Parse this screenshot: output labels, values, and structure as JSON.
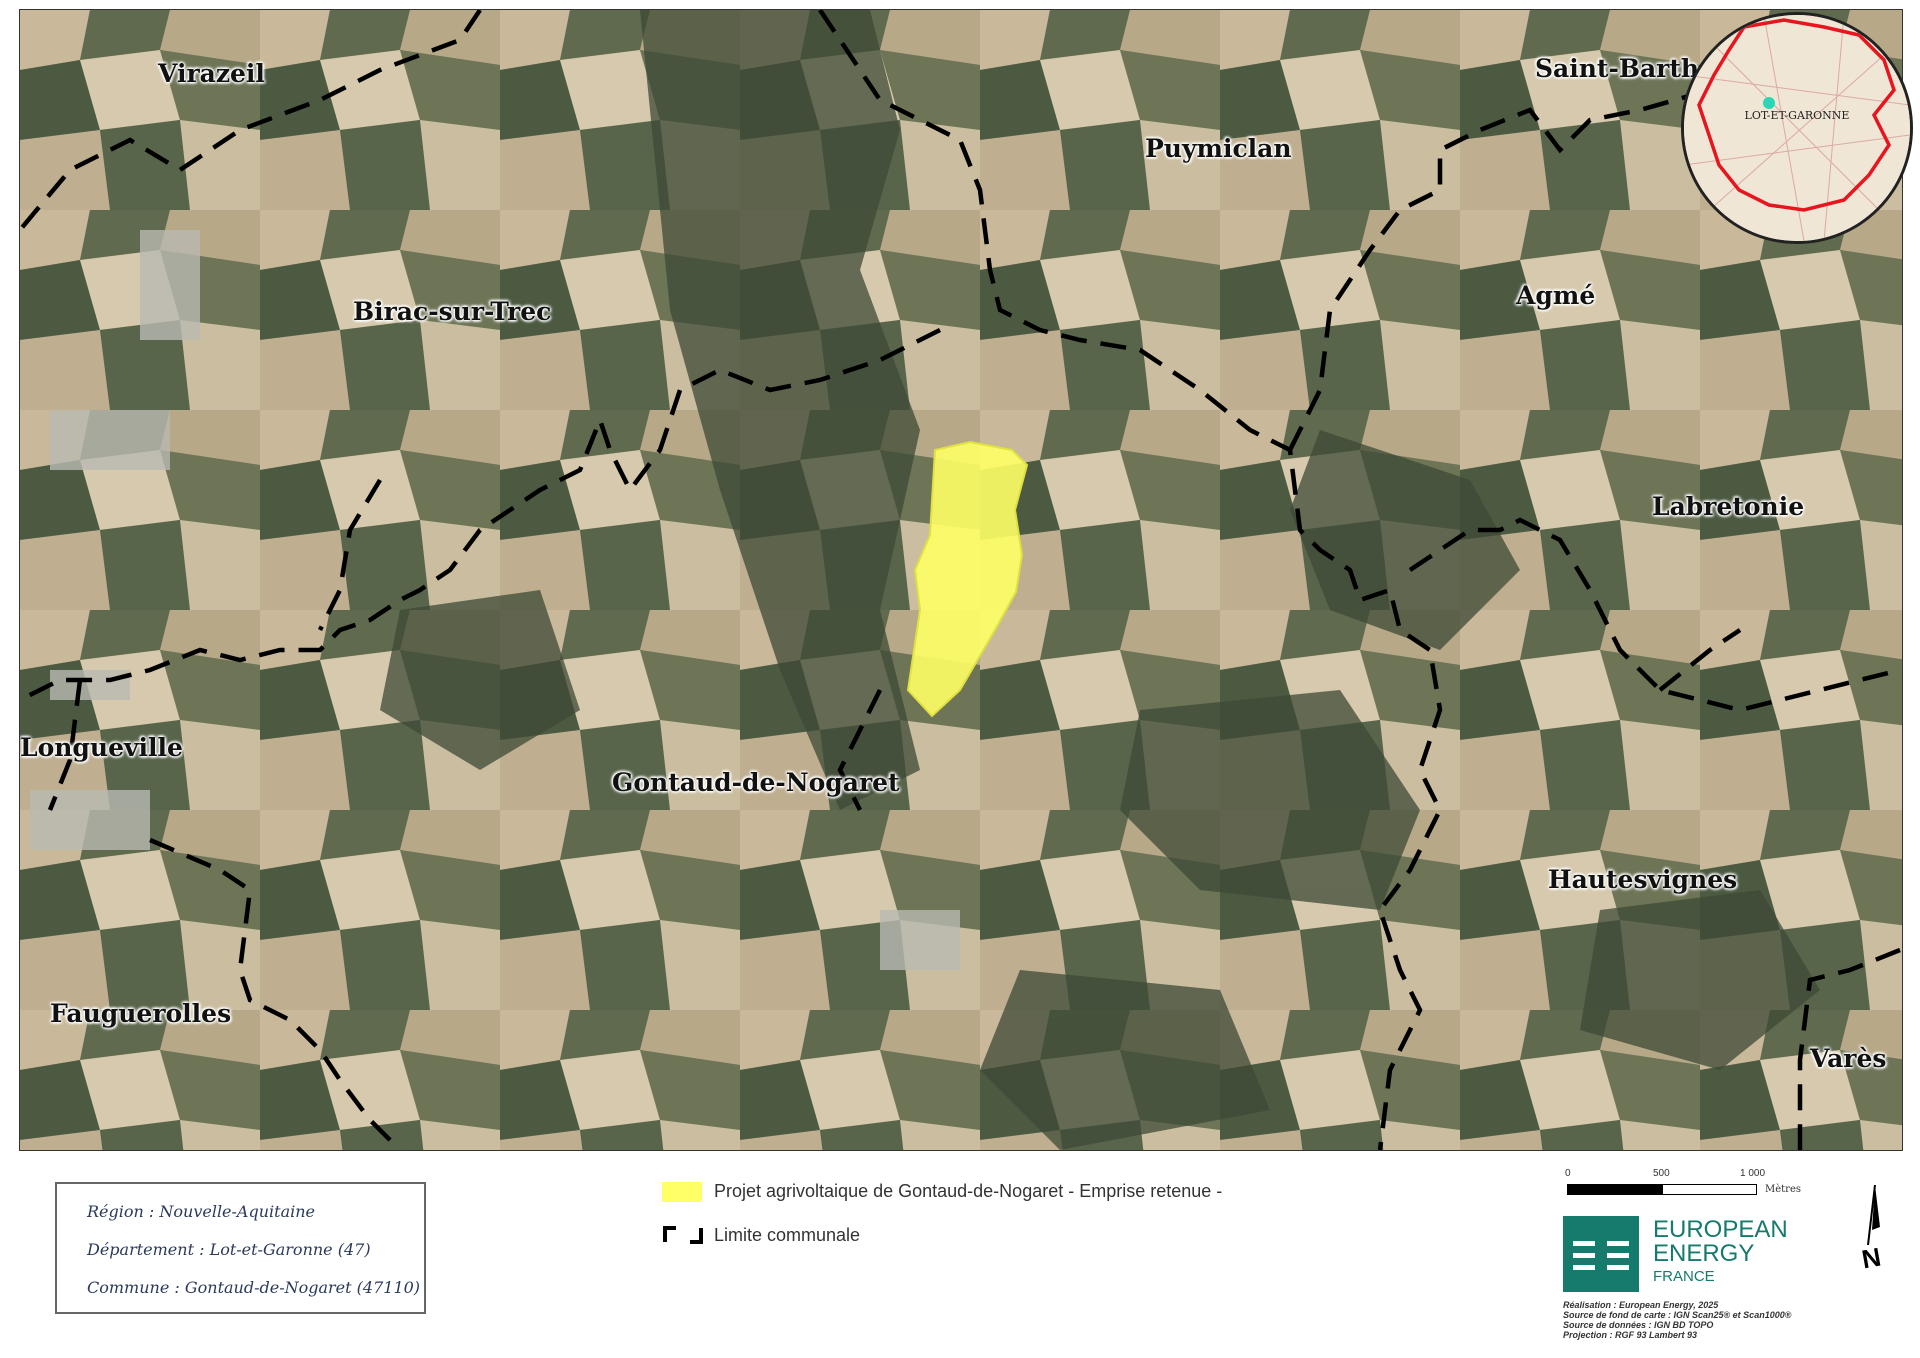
{
  "communes": [
    {
      "id": "virazeil",
      "name": "Virazeil"
    },
    {
      "id": "puymiclan",
      "name": "Puymiclan"
    },
    {
      "id": "saint-barth",
      "name": "Saint-Barth"
    },
    {
      "id": "birac",
      "name": "Birac-sur-Trec"
    },
    {
      "id": "agme",
      "name": "Agmé"
    },
    {
      "id": "labretonie",
      "name": "Labretonie"
    },
    {
      "id": "longueville",
      "name": "Longueville"
    },
    {
      "id": "gontaud",
      "name": "Gontaud-de-Nogaret"
    },
    {
      "id": "hautesvignes",
      "name": "Hautesvignes"
    },
    {
      "id": "fauguerolles",
      "name": "Fauguerolles"
    },
    {
      "id": "vares",
      "name": "Varès"
    }
  ],
  "inset": {
    "label": "LOT-ET-GARONNE"
  },
  "info_box": {
    "region": "Région : Nouvelle-Aquitaine",
    "departement": "Département : Lot-et-Garonne (47)",
    "commune": "Commune : Gontaud-de-Nogaret (47110)"
  },
  "legend": {
    "project": "Projet agrivoltaique de Gontaud-de-Nogaret - Emprise retenue -",
    "boundary": "Limite communale"
  },
  "scale": {
    "tick0": "0",
    "tick1": "500",
    "tick2": "1 000",
    "unit": "Mètres"
  },
  "north": {
    "letter": "N"
  },
  "logo": {
    "line1": "EUROPEAN",
    "line2": "ENERGY",
    "line3": "FRANCE"
  },
  "credits": {
    "realisation": "Réalisation : European Energy, 2025",
    "fond": "Source de fond de carte : IGN Scan25® et Scan1000®",
    "donnees": "Source de données : IGN BD TOPO",
    "projection": "Projection : RGF 93 Lambert 93"
  },
  "colors": {
    "project_fill": "#ffff66",
    "boundary": "#000000",
    "inset_border": "#e8141e",
    "logo": "#167a6c"
  }
}
